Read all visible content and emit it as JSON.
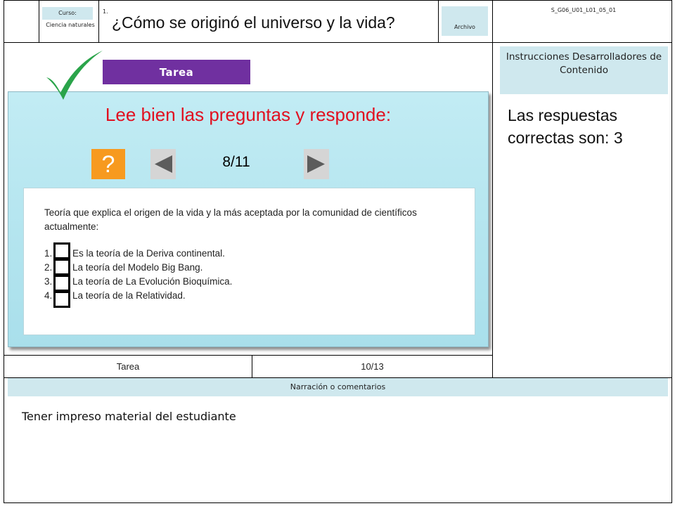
{
  "header": {
    "curso_label": "Curso:",
    "curso_value": "Ciencia naturales",
    "item_number": "1.",
    "title": "¿Cómo se originó el universo y la vida?",
    "archivo_label": "Archivo",
    "code": "S_G06_U01_L01_05_01"
  },
  "content": {
    "tarea_label": "Tarea",
    "heading": "Lee bien las preguntas y responde:",
    "help_label": "?",
    "counter": "8/11",
    "question": "Teoría que explica el origen de la vida y la más aceptada por la comunidad de científicos actualmente:",
    "options": [
      {
        "num": "1.",
        "text": "Es la teoría de la Deriva continental."
      },
      {
        "num": "2.",
        "text": "La teoría del Modelo  Big Bang."
      },
      {
        "num": "3.",
        "text": "La teoría de La  Evolución Bioquímica."
      },
      {
        "num": "4.",
        "text": "La teoría de la Relatividad."
      }
    ]
  },
  "sidebar": {
    "instructions_title": "Instrucciones Desarrolladores de Contenido",
    "answer_text": "Las respuestas correctas son: 3"
  },
  "footer": {
    "type_label": "Tarea",
    "page_label": "10/13",
    "narration_label": "Narración o comentarios",
    "note": "Tener impreso material del estudiante"
  },
  "colors": {
    "accent_purple": "#7030a0",
    "heading_red": "#e11020",
    "panel_blue": "#b9e6ef",
    "help_orange": "#f79a1f",
    "check_green": "#2aa44a"
  },
  "icons": {
    "check": "check-mark-icon",
    "prev": "triangle-left-icon",
    "next": "triangle-right-icon"
  }
}
